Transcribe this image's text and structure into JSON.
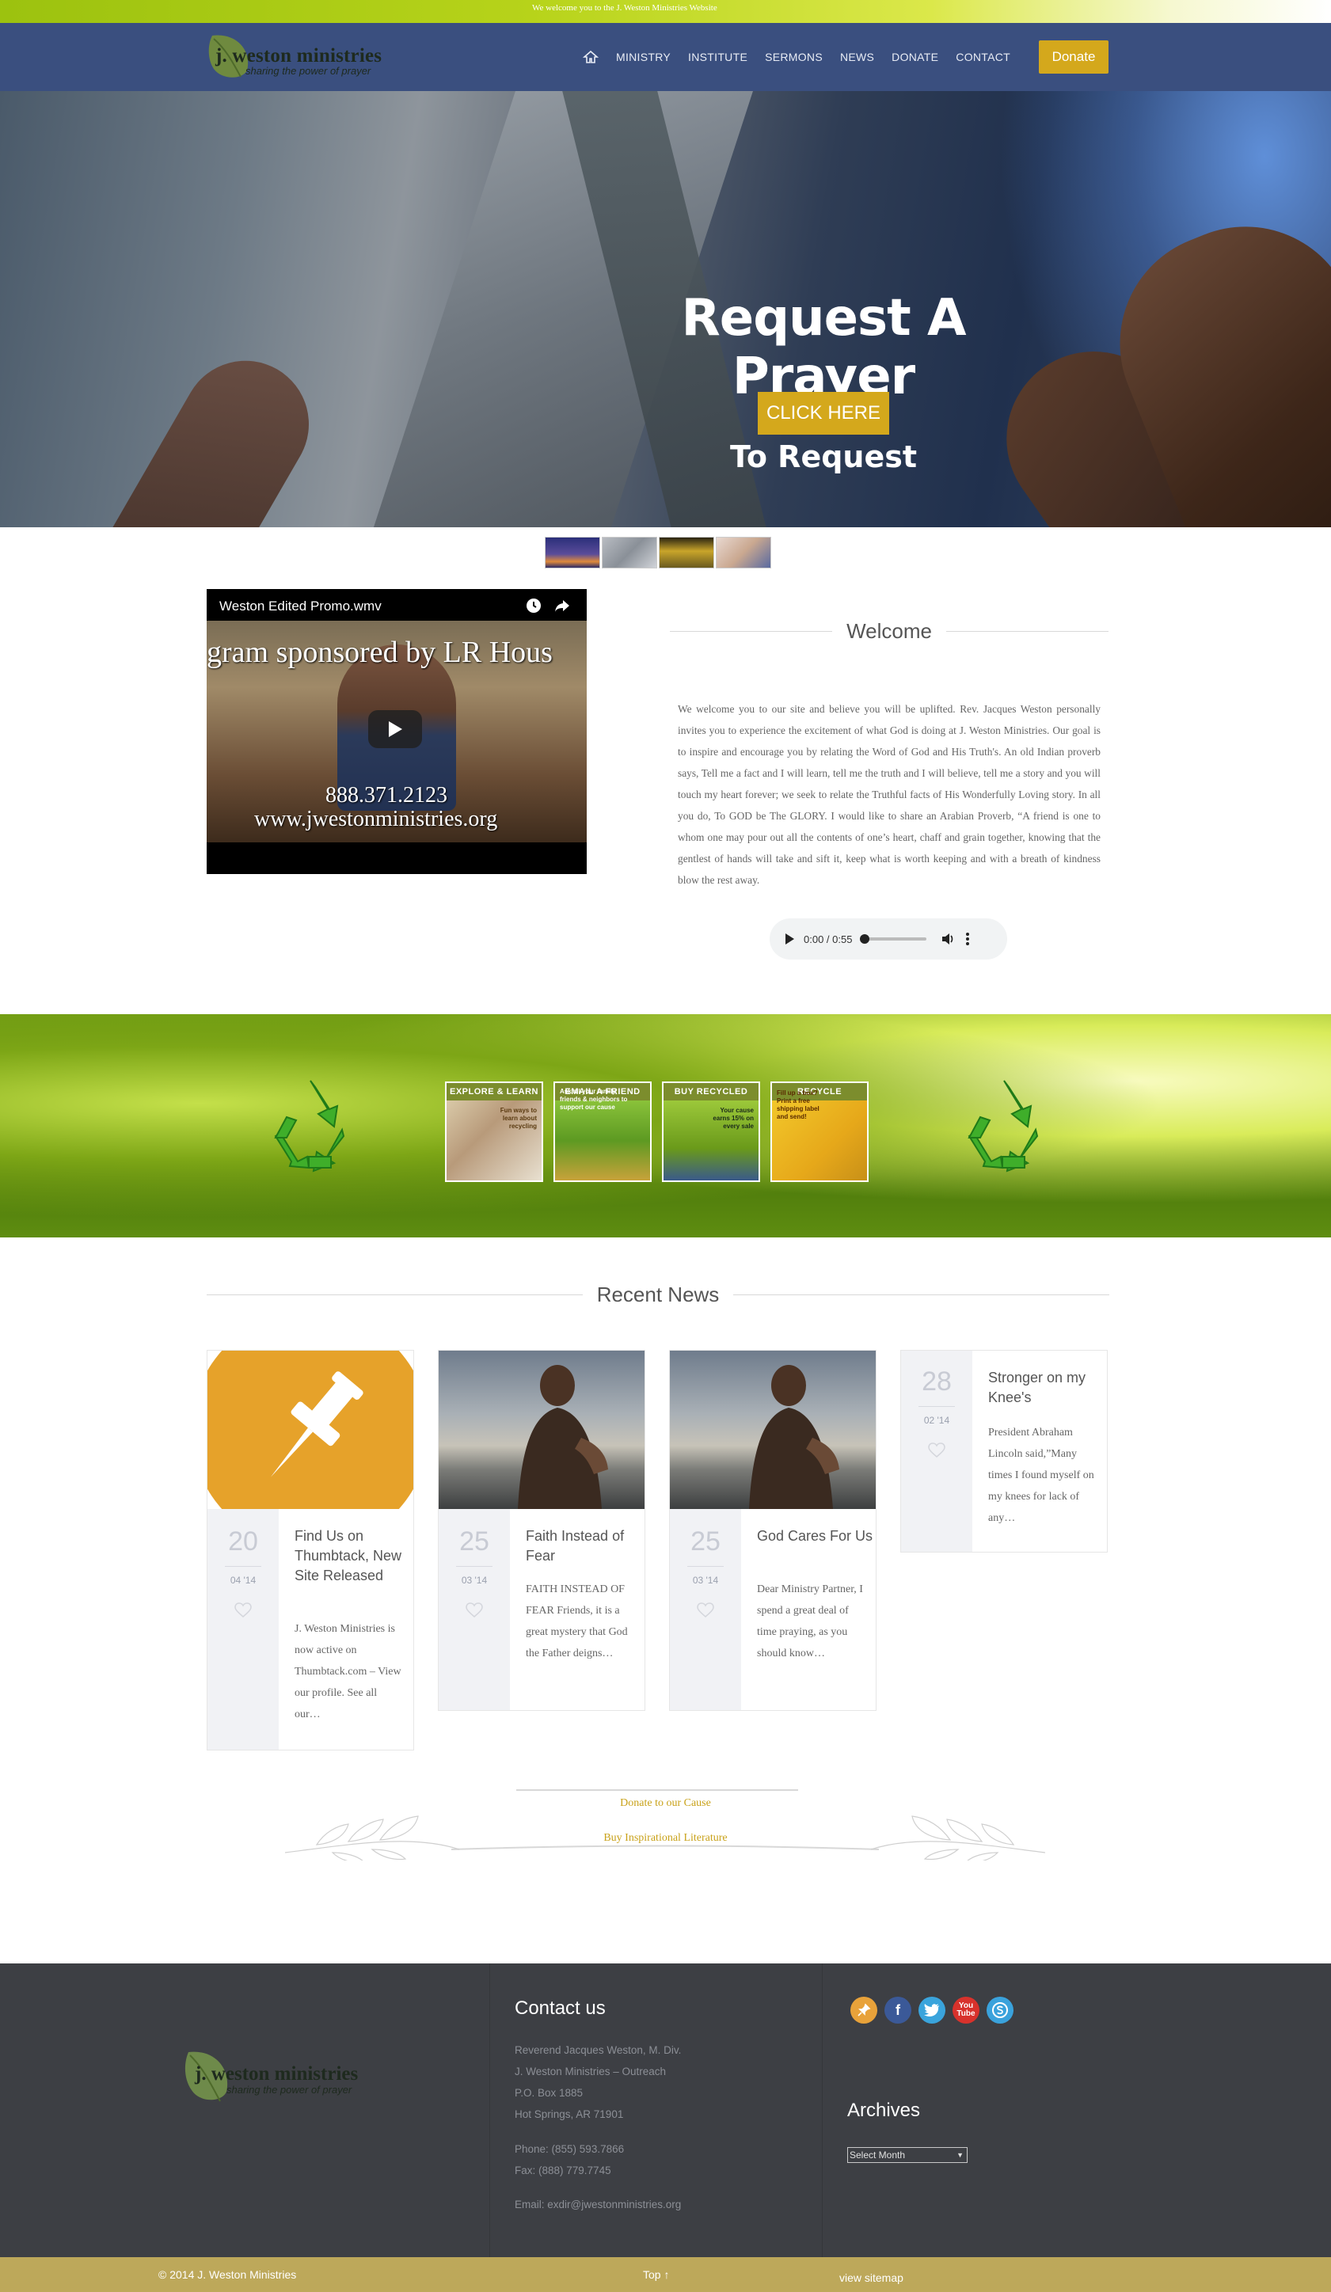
{
  "topbar": {
    "message": "We welcome you to the J. Weston Ministries Website"
  },
  "header": {
    "logo_name": "j. weston ministries",
    "logo_tagline": "sharing the power of prayer",
    "nav": [
      "MINISTRY",
      "INSTITUTE",
      "SERMONS",
      "NEWS",
      "DONATE",
      "CONTACT"
    ],
    "donate_label": "Donate"
  },
  "hero": {
    "title": "Request A Prayer",
    "button_label": "CLICK HERE",
    "subtitle": "To Request"
  },
  "video": {
    "title": "Weston Edited Promo.wmv",
    "banner": "gram sponsored by LR Hous",
    "phone": "888.371.2123",
    "url": "www.jwestonministries.org"
  },
  "welcome": {
    "heading": "Welcome",
    "body": "We welcome you to our site and believe you will be uplifted. Rev. Jacques Weston personally invites you to experience the excitement of what God is doing at J. Weston Ministries. Our goal is to inspire and encourage you by relating the Word of God and His Truth's. An old Indian proverb says, Tell me a fact and I will learn, tell me the truth and I will believe, tell me a story and you will touch my heart forever; we seek to relate the Truthful facts of His Wonderfully Loving story. In all you do, To GOD be The GLORY. I would like to share an Arabian Proverb, “A friend is one to whom one may pour out all the contents of one’s heart, chaff and grain together, knowing that the gentlest of hands will take and sift it, keep what is worth keeping and with a breath of kindness blow the rest away.",
    "audio_time": "0:00 / 0:55"
  },
  "promos": [
    {
      "label": "EXPLORE & LEARN",
      "text": "Fun ways to learn about recycling",
      "color": "#7c8d2d"
    },
    {
      "label": "EMAIL A FRIEND",
      "text": "Ask all your family, friends & neighbors to support our cause",
      "color": "#6f8a2a"
    },
    {
      "label": "BUY RECYCLED",
      "text": "Your cause earns 15% on every sale",
      "color": "#6f8a2a"
    },
    {
      "label": "RECYCLE",
      "text": "Fill up a box? Print a free shipping label and send!",
      "color": "#6f8a2a"
    }
  ],
  "news": {
    "heading": "Recent News",
    "posts": [
      {
        "day": "20",
        "month": "04 '14",
        "likes": "0",
        "title": "Find Us on Thumbtack, New Site Released",
        "excerpt": "J. Weston Ministries is now active on Thumbtack.com – View our profile. See all our…"
      },
      {
        "day": "25",
        "month": "03 '14",
        "likes": "0",
        "title": "Faith Instead of Fear",
        "excerpt": "FAITH INSTEAD OF FEAR Friends, it is a great mystery that God the Father deigns…"
      },
      {
        "day": "25",
        "month": "03 '14",
        "likes": "0",
        "title": "God Cares For Us",
        "excerpt": "Dear Ministry Partner, I spend a great deal of time praying, as you should know…"
      },
      {
        "day": "28",
        "month": "02 '14",
        "likes": "0",
        "title": "Stronger on my Knee's",
        "excerpt": "President Abraham Lincoln said,”Many times I found myself on my knees for lack of any…"
      }
    ]
  },
  "cta": {
    "donate": "Donate to our Cause",
    "literature": "Buy Inspirational Literature"
  },
  "footer": {
    "logo_name": "j. weston ministries",
    "logo_tagline": "sharing the power of prayer",
    "contact_heading": "Contact us",
    "contact_lines": [
      "Reverend Jacques Weston, M. Div.",
      "J. Weston Ministries – Outreach",
      "P.O. Box 1885",
      "Hot Springs, AR 71901"
    ],
    "phone": "Phone: (855) 593.7866",
    "fax": "Fax: (888) 779.7745",
    "email": "Email: exdir@jwestonministries.org",
    "archives_heading": "Archives",
    "archives_select": "Select Month",
    "social": [
      {
        "icon": "thumbtack-icon",
        "glyph": "↗",
        "color": "#e8a23a"
      },
      {
        "icon": "facebook-icon",
        "glyph": "f",
        "color": "#3b5998"
      },
      {
        "icon": "twitter-icon",
        "glyph": "t",
        "color": "#3aa4dc"
      },
      {
        "icon": "youtube-icon",
        "glyph": "▶",
        "color": "#d8322c"
      },
      {
        "icon": "skype-icon",
        "glyph": "S",
        "color": "#3aa2dc"
      }
    ]
  },
  "bottombar": {
    "copyright": "© 2014 J. Weston Ministries",
    "top_link": "Top ↑",
    "sitemap": "view sitemap"
  }
}
